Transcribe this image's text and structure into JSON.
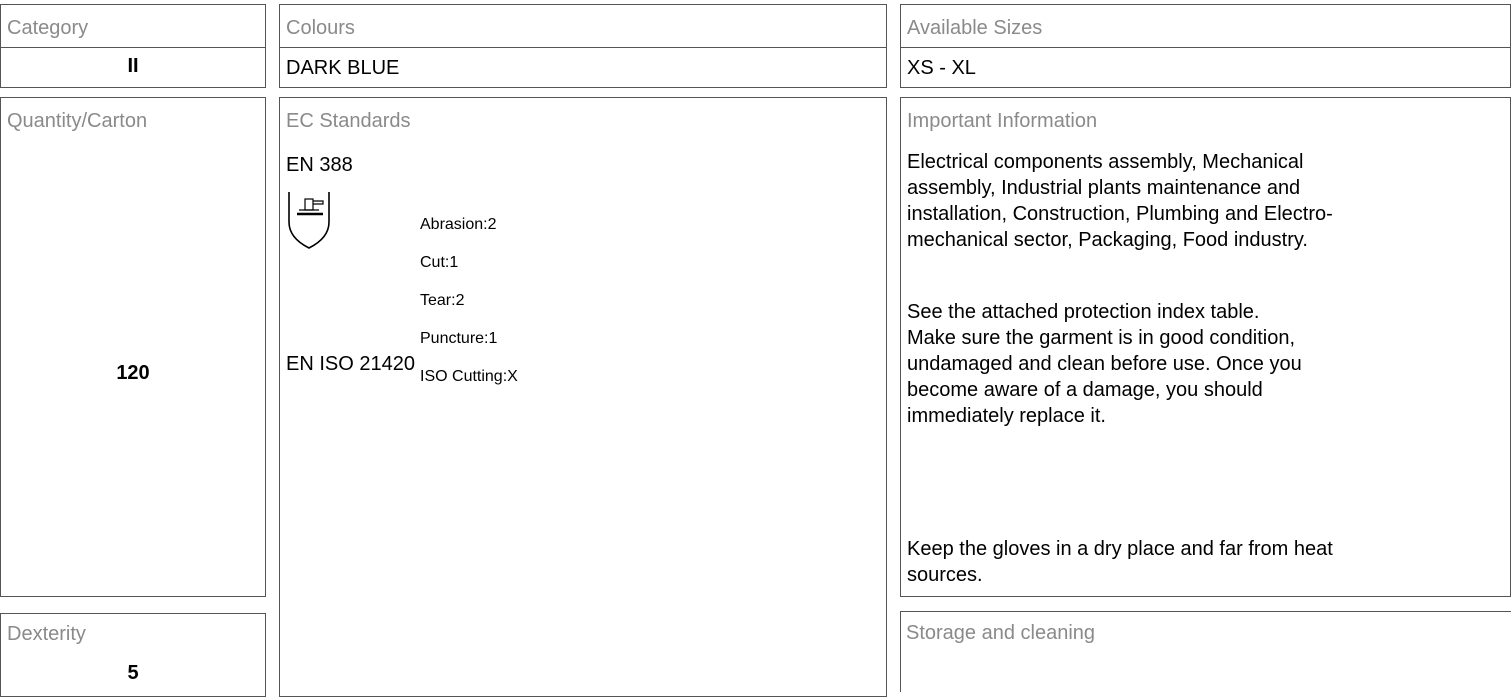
{
  "category": {
    "label": "Category",
    "value": "II"
  },
  "colours": {
    "label": "Colours",
    "value": "DARK BLUE"
  },
  "sizes": {
    "label": "Available Sizes",
    "value": "XS - XL"
  },
  "quantity": {
    "label": "Quantity/Carton",
    "value": "120"
  },
  "standards": {
    "label": "EC Standards",
    "en388": {
      "name": "EN 388",
      "icon": "hand-shield-icon",
      "ratings": [
        "Abrasion:2",
        "Cut:1",
        "Tear:2",
        "Puncture:1",
        "ISO Cutting:X"
      ]
    },
    "iso21420": {
      "name": "EN ISO 21420"
    }
  },
  "info": {
    "label": "Important Information",
    "applications": "Electrical components assembly, Mechanical\nassembly, Industrial plants maintenance and\ninstallation, Construction, Plumbing and Electro-\nmechanical sector, Packaging, Food industry.",
    "instructions": "See the attached protection index table.\nMake sure the garment is in good condition,\nundamaged and clean before use. Once you\nbecome aware of a damage, you should\nimmediately replace it.",
    "storage": "Keep the gloves in a dry place and far from heat\nsources."
  },
  "dexterity": {
    "label": "Dexterity",
    "value": "5"
  },
  "storage_cleaning": {
    "label": "Storage and cleaning"
  }
}
